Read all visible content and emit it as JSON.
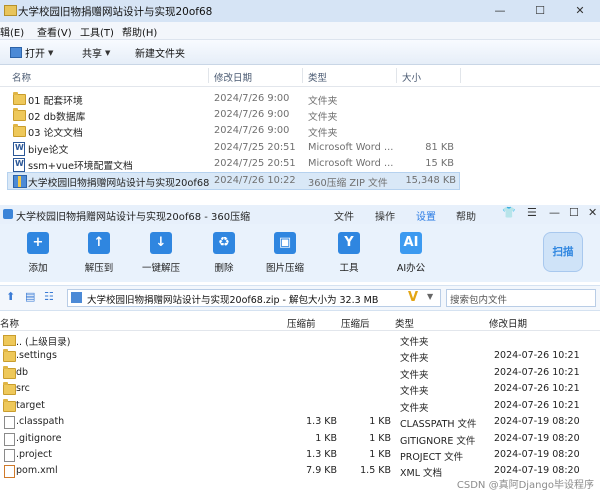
{
  "explorer": {
    "title": "大学校园旧物捐赠网站设计与实现20of68",
    "window_buttons": [
      "—",
      "☐",
      "✕"
    ],
    "menu": [
      "辑(E)",
      "查看(V)",
      "工具(T)",
      "帮助(H)"
    ],
    "toolbar": {
      "open": "打开",
      "share": "共享",
      "new_folder": "新建文件夹"
    },
    "columns": {
      "name": "名称",
      "modified": "修改日期",
      "type": "类型",
      "size": "大小"
    },
    "rows": [
      {
        "name": "01 配套环境",
        "modified": "2024/7/26 9:00",
        "type": "文件夹",
        "size": ""
      },
      {
        "name": "02 db数据库",
        "modified": "2024/7/26 9:00",
        "type": "文件夹",
        "size": ""
      },
      {
        "name": "03 论文文档",
        "modified": "2024/7/26 9:00",
        "type": "文件夹",
        "size": ""
      },
      {
        "name": "biye论文",
        "modified": "2024/7/25 20:51",
        "type": "Microsoft Word ...",
        "size": "81 KB"
      },
      {
        "name": "ssm+vue环境配置文档",
        "modified": "2024/7/25 20:51",
        "type": "Microsoft Word ...",
        "size": "15 KB"
      },
      {
        "name": "大学校园旧物捐赠网站设计与实现20of68",
        "modified": "2024/7/26 10:22",
        "type": "360压缩 ZIP 文件",
        "size": "15,348 KB"
      }
    ]
  },
  "zip": {
    "title": "大学校园旧物捐赠网站设计与实现20of68 - 360压缩",
    "menu": [
      "文件",
      "操作",
      "设置",
      "帮助"
    ],
    "tools": [
      "添加",
      "解压到",
      "一键解压",
      "删除",
      "图片压缩",
      "工具",
      "AI办公"
    ],
    "scan": "扫描",
    "address": "大学校园旧物捐赠网站设计与实现20of68.zip - 解包大小为 32.3 MB",
    "search_placeholder": "搜索包内文件",
    "columns": {
      "name": "名称",
      "packed": "压缩前",
      "compressed": "压缩后",
      "type": "类型",
      "modified": "修改日期"
    },
    "rows": [
      {
        "name": ".. (上级目录)",
        "packed": "",
        "compressed": "",
        "type": "文件夹",
        "modified": ""
      },
      {
        "name": ".settings",
        "packed": "",
        "compressed": "",
        "type": "文件夹",
        "modified": "2024-07-26 10:21"
      },
      {
        "name": "db",
        "packed": "",
        "compressed": "",
        "type": "文件夹",
        "modified": "2024-07-26 10:21"
      },
      {
        "name": "src",
        "packed": "",
        "compressed": "",
        "type": "文件夹",
        "modified": "2024-07-26 10:21"
      },
      {
        "name": "target",
        "packed": "",
        "compressed": "",
        "type": "文件夹",
        "modified": "2024-07-26 10:21"
      },
      {
        "name": ".classpath",
        "packed": "1.3 KB",
        "compressed": "1 KB",
        "type": "CLASSPATH 文件",
        "modified": "2024-07-19 08:20"
      },
      {
        "name": ".gitignore",
        "packed": "1 KB",
        "compressed": "1 KB",
        "type": "GITIGNORE 文件",
        "modified": "2024-07-19 08:20"
      },
      {
        "name": ".project",
        "packed": "1.3 KB",
        "compressed": "1 KB",
        "type": "PROJECT 文件",
        "modified": "2024-07-19 08:20"
      },
      {
        "name": "pom.xml",
        "packed": "7.9 KB",
        "compressed": "1.5 KB",
        "type": "XML 文档",
        "modified": "2024-07-19 08:20"
      }
    ]
  },
  "watermark": "CSDN @真阿Django毕设程序"
}
